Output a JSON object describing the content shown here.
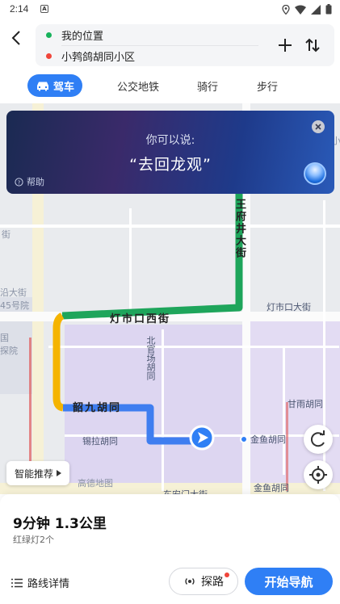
{
  "status_bar": {
    "time": "2:14",
    "notification_icon": "A"
  },
  "route": {
    "from": "我的位置",
    "to": "小鹁鸽胡同小区"
  },
  "tabs": [
    {
      "label": "驾车",
      "active": true
    },
    {
      "label": "公交地铁"
    },
    {
      "label": "骑行"
    },
    {
      "label": "步行"
    }
  ],
  "voice": {
    "hint": "你可以说:",
    "phrase": "“去回龙观”",
    "help": "帮助"
  },
  "map": {
    "roads": {
      "wangfujing": "王府井大街",
      "dengshikou_west": "灯市口西街",
      "dengshikou_main": "灯市口大街",
      "shaojiu": "韶九胡同",
      "beixiechang": "北官场胡同",
      "xila": "锡拉胡同",
      "ganyu": "甘雨胡同",
      "jinyu": "金鱼胡同",
      "jinyu2": "金鱼胡同",
      "dongankou": "东安门大街",
      "side_partial_1": "沿大街",
      "side_partial_2": "45号院",
      "side_partial_3": "国",
      "side_partial_4": "探院",
      "edge_left": "街",
      "edge_right": "小"
    },
    "watermark": "高德地图",
    "colors": {
      "route_green": "#1ea55b",
      "route_yellow": "#f5b400",
      "route_blue": "#3f7ef0",
      "lavender": "#ddd6f1"
    }
  },
  "smart_recommend": "智能推荐",
  "summary": {
    "eta": "9分钟  1.3公里",
    "lights": "红绿灯2个"
  },
  "actions": {
    "details": "路线详情",
    "explore": "探路",
    "start": "开始导航"
  }
}
